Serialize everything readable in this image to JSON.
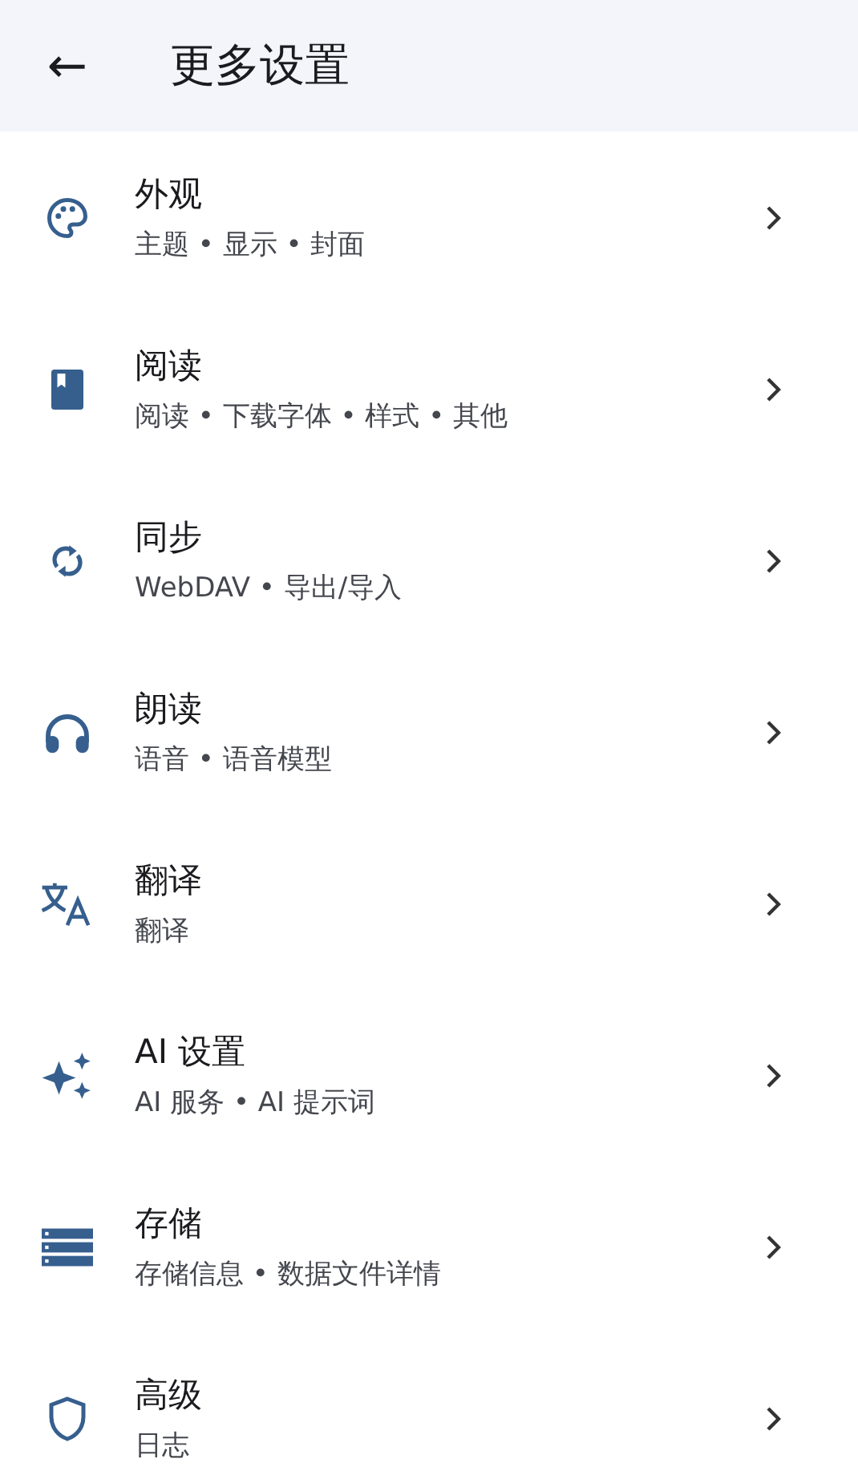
{
  "header": {
    "back": "←",
    "title": "更多设置"
  },
  "items": [
    {
      "title": "外观",
      "subtitle": "主题 • 显示 • 封面"
    },
    {
      "title": "阅读",
      "subtitle": "阅读 • 下载字体 • 样式 • 其他"
    },
    {
      "title": "同步",
      "subtitle": "WebDAV • 导出/导入"
    },
    {
      "title": "朗读",
      "subtitle": "语音 • 语音模型"
    },
    {
      "title": "翻译",
      "subtitle": "翻译"
    },
    {
      "title": "AI 设置",
      "subtitle": "AI 服务 • AI 提示词"
    },
    {
      "title": "存储",
      "subtitle": "存储信息 • 数据文件详情"
    },
    {
      "title": "高级",
      "subtitle": "日志"
    }
  ]
}
